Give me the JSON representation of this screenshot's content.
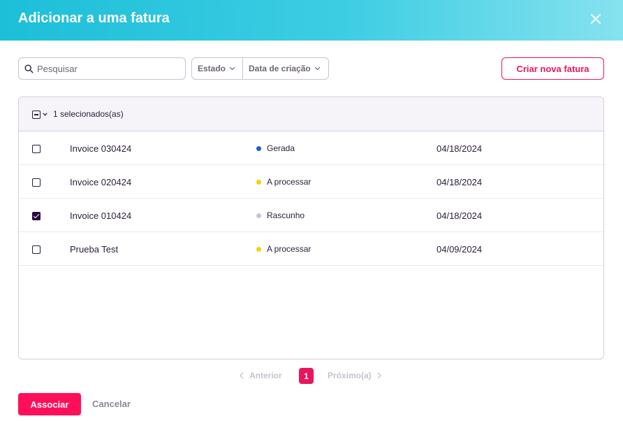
{
  "header": {
    "title": "Adicionar a uma fatura",
    "close_icon": "close-icon"
  },
  "toolbar": {
    "search_placeholder": "Pesquisar",
    "search_value": "",
    "filters": [
      {
        "label": "Estado"
      },
      {
        "label": "Data de criação"
      }
    ],
    "create_label": "Criar nova fatura"
  },
  "table": {
    "selected_label": "1 selecionados(as)",
    "rows": [
      {
        "name": "Invoice 030424",
        "status": "Gerada",
        "status_color": "#1a5fd0",
        "date": "04/18/2024",
        "checked": false
      },
      {
        "name": "Invoice 020424",
        "status": "A processar",
        "status_color": "#f5d20a",
        "date": "04/18/2024",
        "checked": false
      },
      {
        "name": "Invoice 010424",
        "status": "Rascunho",
        "status_color": "#c9c6d1",
        "date": "04/18/2024",
        "checked": true
      },
      {
        "name": "Prueba Test",
        "status": "A processar",
        "status_color": "#f5d20a",
        "date": "04/09/2024",
        "checked": false
      }
    ]
  },
  "pagination": {
    "prev": "Anterior",
    "page": "1",
    "next": "Próximo(a)"
  },
  "footer": {
    "associate_label": "Associar",
    "cancel_label": "Cancelar"
  },
  "colors": {
    "accent": "#e8175d",
    "header_from": "#1cbfd8",
    "header_to": "#86e2ef"
  }
}
